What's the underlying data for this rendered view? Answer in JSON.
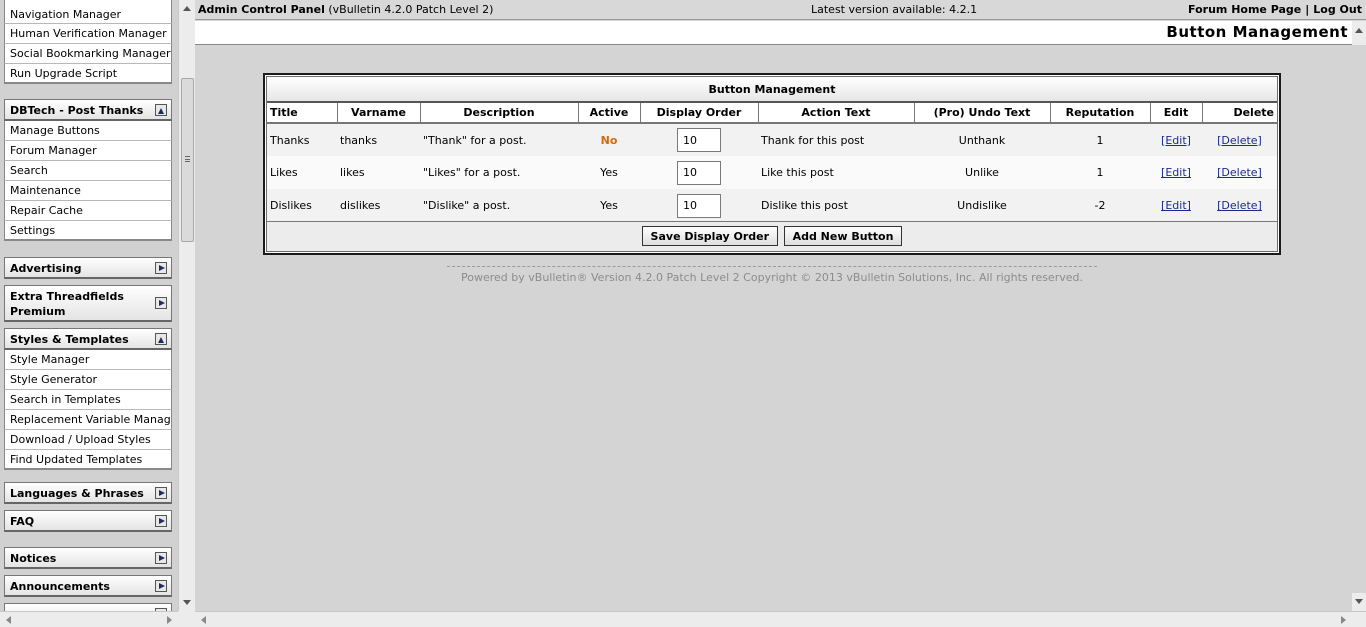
{
  "sidebar": {
    "group_top": [
      "Navigation Manager",
      "Human Verification Manager",
      "Social Bookmarking Manager",
      "Run Upgrade Script"
    ],
    "dbtech": {
      "header": "DBTech - Post Thanks",
      "items": [
        "Manage Buttons",
        "Forum Manager",
        "Search",
        "Maintenance",
        "Repair Cache",
        "Settings"
      ]
    },
    "advertising": "Advertising",
    "extra_threadfields": "Extra Threadfields Premium",
    "styles": {
      "header": "Styles & Templates",
      "items": [
        "Style Manager",
        "Style Generator",
        "Search in Templates",
        "Replacement Variable Manager",
        "Download / Upload Styles",
        "Find Updated Templates"
      ]
    },
    "languages": "Languages & Phrases",
    "faq": "FAQ",
    "notices": "Notices",
    "announcements": "Announcements"
  },
  "topbar": {
    "title": "Admin Control Panel",
    "version": "(vBulletin 4.2.0 Patch Level 2)",
    "latest": "Latest version available: 4.2.1",
    "forum_home": "Forum Home Page",
    "separator": "|",
    "logout": "Log Out"
  },
  "page_title": "Button Management",
  "panel": {
    "title": "Button Management",
    "columns": [
      "Title",
      "Varname",
      "Description",
      "Active",
      "Display Order",
      "Action Text",
      "(Pro) Undo Text",
      "Reputation",
      "Edit",
      "Delete"
    ],
    "rows": [
      {
        "title": "Thanks",
        "varname": "thanks",
        "description": "\"Thank\" for a post.",
        "active": "No",
        "order": "10",
        "action": "Thank for this post",
        "undo": "Unthank",
        "reputation": "1",
        "edit": "[Edit]",
        "delete": "[Delete]"
      },
      {
        "title": "Likes",
        "varname": "likes",
        "description": "\"Likes\" for a post.",
        "active": "Yes",
        "order": "10",
        "action": "Like this post",
        "undo": "Unlike",
        "reputation": "1",
        "edit": "[Edit]",
        "delete": "[Delete]"
      },
      {
        "title": "Dislikes",
        "varname": "dislikes",
        "description": "\"Dislike\" a post.",
        "active": "Yes",
        "order": "10",
        "action": "Dislike this post",
        "undo": "Undislike",
        "reputation": "-2",
        "edit": "[Edit]",
        "delete": "[Delete]"
      }
    ],
    "save_button": "Save Display Order",
    "add_button": "Add New Button"
  },
  "footer": {
    "copyright": "Powered by vBulletin® Version 4.2.0 Patch Level 2 Copyright © 2013 vBulletin Solutions, Inc. All rights reserved."
  },
  "colors": {
    "inactive_text": "#d06a0a",
    "link": "#1a2b8a"
  }
}
